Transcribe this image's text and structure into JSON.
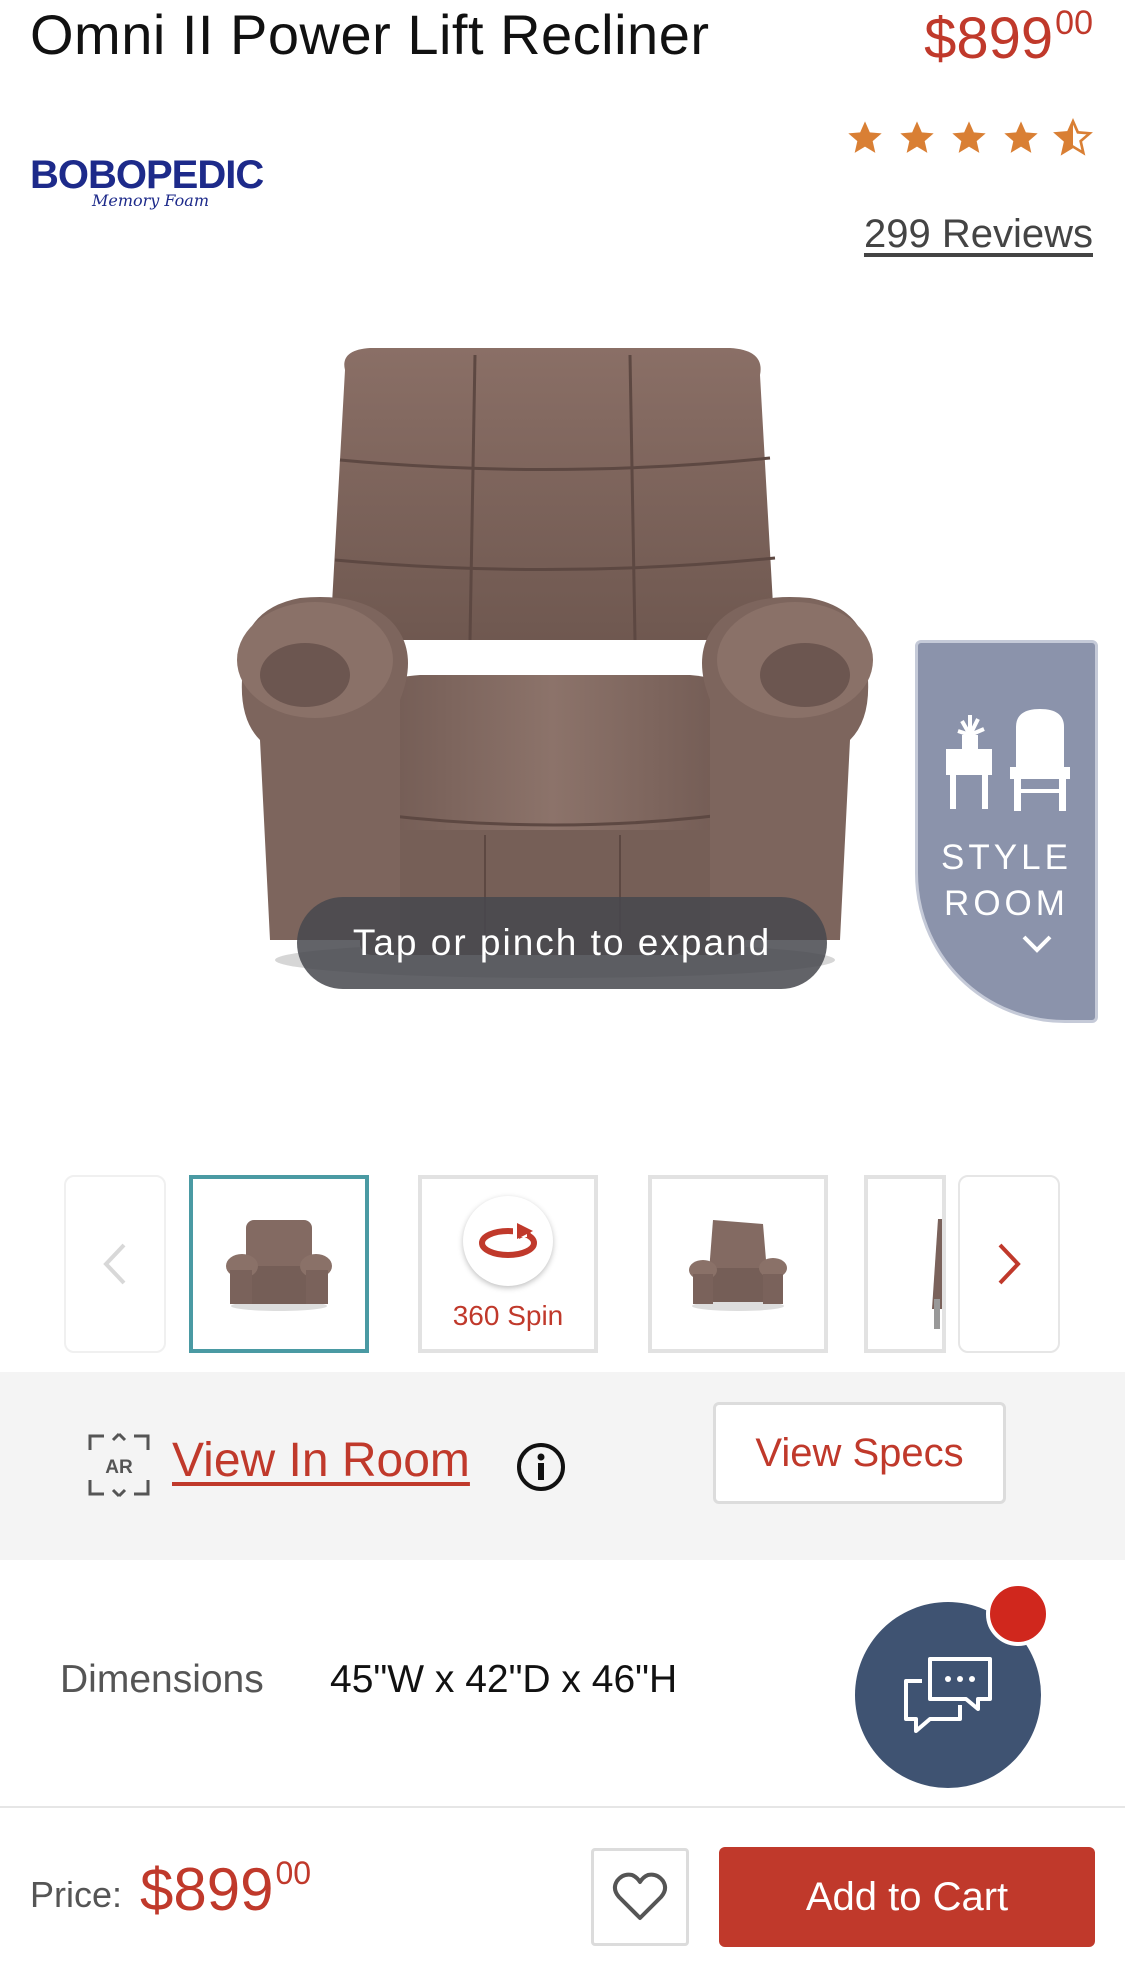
{
  "header": {
    "title": "Omni II Power Lift Recliner",
    "price_dollars": "$899",
    "price_cents": "00"
  },
  "brand": {
    "name": "BOBOPEDIC",
    "tagline": "Memory Foam",
    "color": "#1d2a8a"
  },
  "rating": {
    "stars": 4.5,
    "max": 5,
    "reviews_label": "299 Reviews",
    "star_color": "#d97f34"
  },
  "image": {
    "expand_hint": "Tap or pinch to expand"
  },
  "style_room": {
    "line1": "STYLE",
    "line2": "ROOM",
    "icon": "furniture-icon"
  },
  "thumbnails": {
    "items": [
      {
        "type": "image",
        "active": true
      },
      {
        "type": "spin",
        "label": "360 Spin"
      },
      {
        "type": "image",
        "active": false
      },
      {
        "type": "image",
        "active": false
      }
    ]
  },
  "actions": {
    "ar_badge": "AR",
    "view_in_room": "View In Room",
    "view_specs": "View Specs"
  },
  "dimensions": {
    "label": "Dimensions",
    "value": "45\"W x 42\"D x 46\"H"
  },
  "bottom_bar": {
    "price_label": "Price:",
    "price_dollars": "$899",
    "price_cents": "00",
    "add_to_cart": "Add to Cart"
  },
  "colors": {
    "accent": "#c0392b",
    "chat": "#3f5372",
    "thumb_active": "#4a9aa3",
    "style_room_bg": "#8b93ab"
  }
}
